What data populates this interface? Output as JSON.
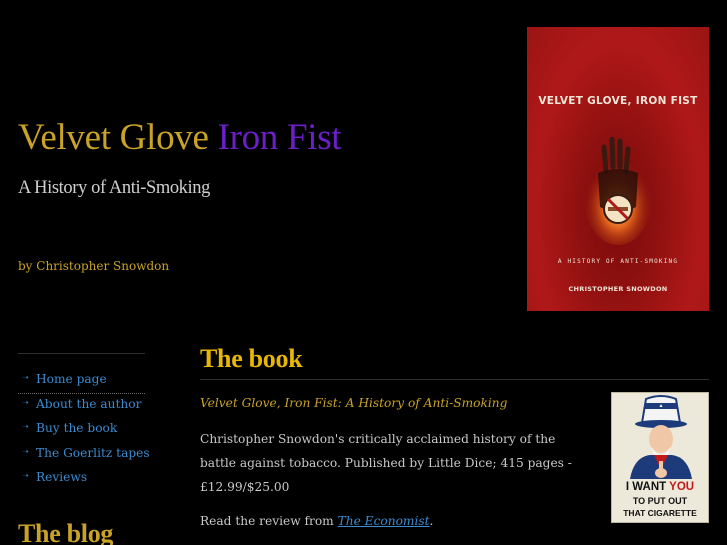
{
  "header": {
    "title_part1": "Velvet Glove",
    "title_part2": "Iron Fist",
    "subtitle": "A History of Anti-Smoking",
    "byline": "by Christopher Snowdon"
  },
  "book_cover": {
    "title": "VELVET GLOVE, IRON FIST",
    "subtitle": "A HISTORY OF ANTI-SMOKING",
    "author": "CHRISTOPHER SNOWDON"
  },
  "sidebar": {
    "items": [
      {
        "label": "Home page"
      },
      {
        "label": "About the author"
      },
      {
        "label": "Buy the book"
      },
      {
        "label": "The Goerlitz tapes"
      },
      {
        "label": "Reviews"
      }
    ],
    "blog_heading": "The blog"
  },
  "main": {
    "heading": "The book",
    "book_subtitle": "Velvet Glove, Iron Fist: A History of Anti-Smoking",
    "description": "Christopher Snowdon's critically acclaimed history of the battle against tobacco. Published by Little Dice; 415 pages - £12.99/$25.00",
    "review_prefix": "Read the review from ",
    "review_link": "The Economist",
    "review_suffix": "."
  },
  "poster": {
    "line1_a": "I WANT ",
    "line1_b": "YOU",
    "line2": "TO PUT OUT",
    "line3": "THAT CIGARETTE"
  },
  "colors": {
    "background": "#000000",
    "title_gold": "#c9a227",
    "title_purple": "#6a1fc7",
    "heading_yellow": "#e8b800",
    "link_blue": "#3b8bd0",
    "body_text": "#c9c9c9"
  }
}
